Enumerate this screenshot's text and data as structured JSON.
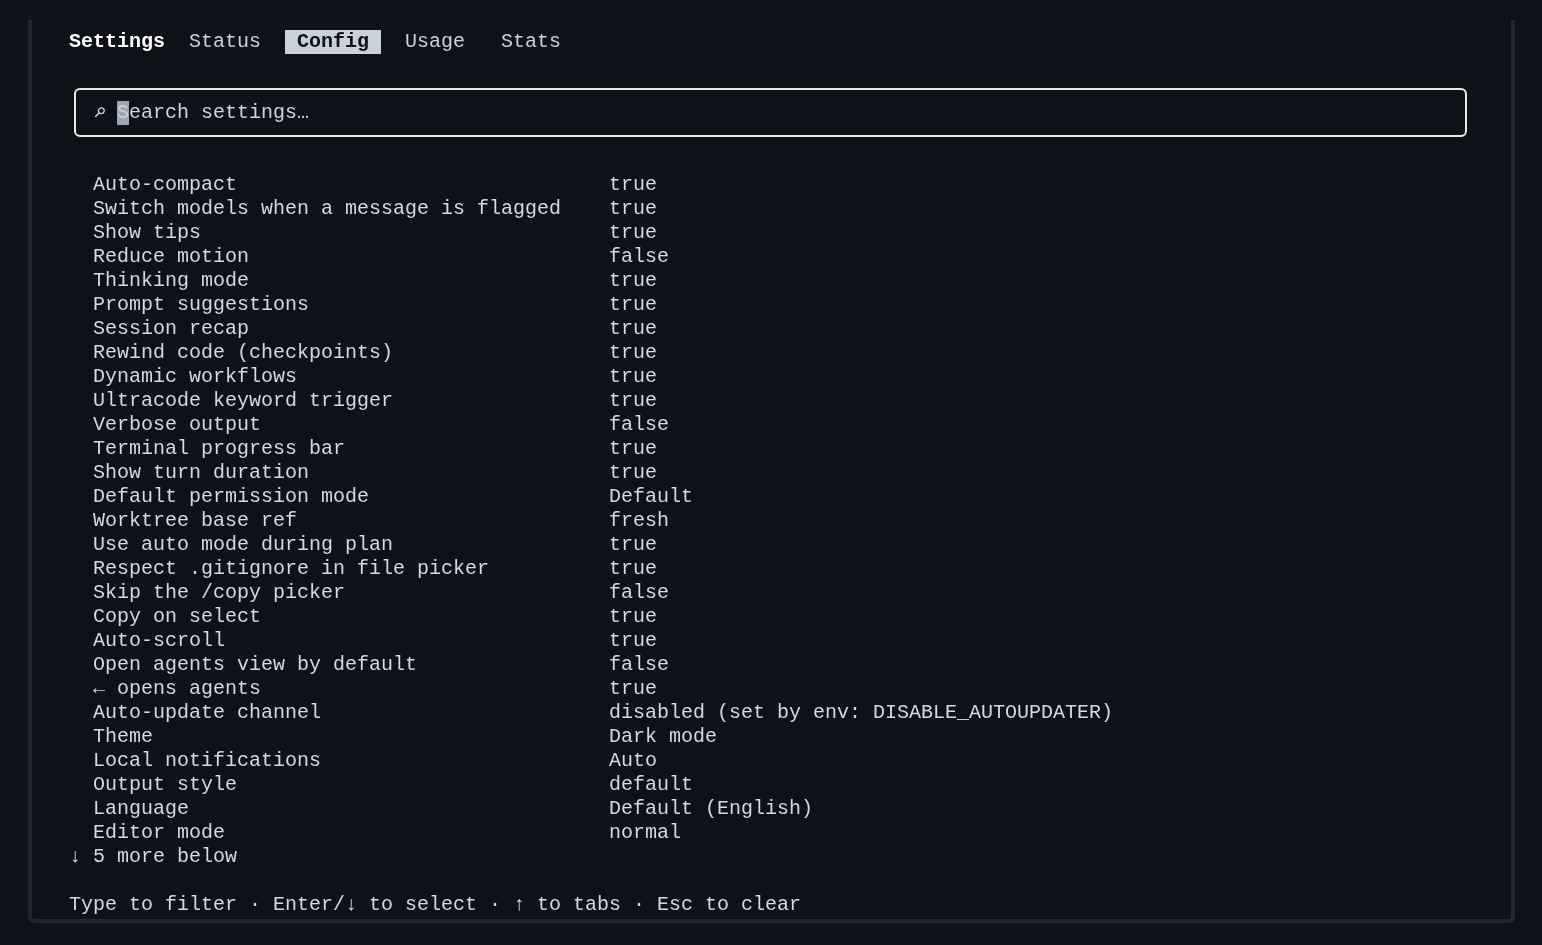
{
  "tabs_bar": {
    "title": "Settings",
    "tabs": [
      {
        "label": "Status",
        "selected": false
      },
      {
        "label": "Config",
        "selected": true
      },
      {
        "label": "Usage",
        "selected": false
      },
      {
        "label": "Stats",
        "selected": false
      }
    ]
  },
  "search": {
    "placeholder": "Search settings…",
    "focused": true
  },
  "settings": [
    {
      "label": "Auto-compact",
      "value": "true"
    },
    {
      "label": "Switch models when a message is flagged",
      "value": "true"
    },
    {
      "label": "Show tips",
      "value": "true"
    },
    {
      "label": "Reduce motion",
      "value": "false"
    },
    {
      "label": "Thinking mode",
      "value": "true"
    },
    {
      "label": "Prompt suggestions",
      "value": "true"
    },
    {
      "label": "Session recap",
      "value": "true"
    },
    {
      "label": "Rewind code (checkpoints)",
      "value": "true"
    },
    {
      "label": "Dynamic workflows",
      "value": "true"
    },
    {
      "label": "Ultracode keyword trigger",
      "value": "true"
    },
    {
      "label": "Verbose output",
      "value": "false"
    },
    {
      "label": "Terminal progress bar",
      "value": "true"
    },
    {
      "label": "Show turn duration",
      "value": "true"
    },
    {
      "label": "Default permission mode",
      "value": "Default"
    },
    {
      "label": "Worktree base ref",
      "value": "fresh"
    },
    {
      "label": "Use auto mode during plan",
      "value": "true"
    },
    {
      "label": "Respect .gitignore in file picker",
      "value": "true"
    },
    {
      "label": "Skip the /copy picker",
      "value": "false"
    },
    {
      "label": "Copy on select",
      "value": "true"
    },
    {
      "label": "Auto-scroll",
      "value": "true"
    },
    {
      "label": "Open agents view by default",
      "value": "false"
    },
    {
      "label": "← opens agents",
      "value": "true"
    },
    {
      "label": "Auto-update channel",
      "value": "disabled (set by env: DISABLE_AUTOUPDATER)"
    },
    {
      "label": "Theme",
      "value": "Dark mode"
    },
    {
      "label": "Local notifications",
      "value": "Auto"
    },
    {
      "label": "Output style",
      "value": "default"
    },
    {
      "label": "Language",
      "value": "Default (English)"
    },
    {
      "label": "Editor mode",
      "value": "normal"
    }
  ],
  "more_below": "↓ 5 more below",
  "footer_hint": "Type to filter · Enter/↓ to select · ↑ to tabs · Esc to clear"
}
